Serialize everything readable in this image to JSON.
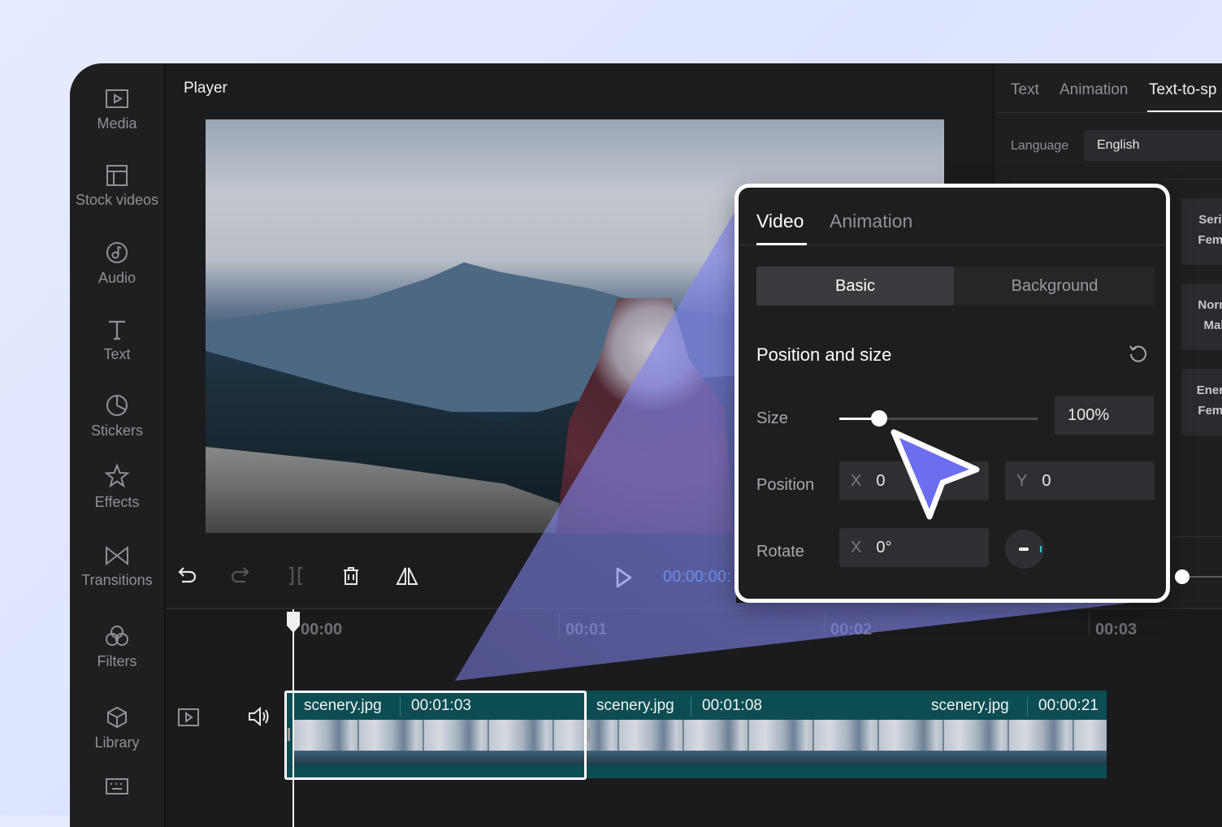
{
  "sidebar": {
    "items": [
      {
        "label": "Media",
        "icon": "play-square-icon"
      },
      {
        "label": "Stock videos",
        "icon": "layout-icon"
      },
      {
        "label": "Audio",
        "icon": "music-note-icon"
      },
      {
        "label": "Text",
        "icon": "text-t-icon"
      },
      {
        "label": "Stickers",
        "icon": "sticker-icon"
      },
      {
        "label": "Effects",
        "icon": "sparkle-star-icon"
      },
      {
        "label": "Transitions",
        "icon": "bowtie-icon"
      },
      {
        "label": "Filters",
        "icon": "filter-circles-icon"
      },
      {
        "label": "Library",
        "icon": "cube-icon"
      },
      {
        "label": "",
        "icon": "keyboard-icon"
      }
    ]
  },
  "player": {
    "title": "Player",
    "timecode": "00:00:00:"
  },
  "right_panel": {
    "tabs": [
      "Text",
      "Animation",
      "Text-to-sp"
    ],
    "active_tab": "Text-to-sp",
    "language_label": "Language",
    "language_value": "English",
    "voices": [
      "Serio\nFema",
      "Norm\nMal",
      "Energ\nFema"
    ]
  },
  "timeline": {
    "ticks": [
      "00:00",
      "00:01",
      "00:02",
      "00:03"
    ],
    "clips": [
      {
        "name": "scenery.jpg",
        "duration": "00:01:03"
      },
      {
        "name": "scenery.jpg",
        "duration": "00:01:08"
      },
      {
        "name": "scenery.jpg",
        "duration": "00:00:21"
      }
    ]
  },
  "video_panel": {
    "tabs": [
      "Video",
      "Animation"
    ],
    "segments": [
      "Basic",
      "Background"
    ],
    "section_title": "Position and size",
    "size_label": "Size",
    "size_value": "100%",
    "size_slider_fraction": 0.2,
    "position_label": "Position",
    "position_x_axis": "X",
    "position_x": "0",
    "position_y_axis": "Y",
    "position_y": "0",
    "rotate_label": "Rotate",
    "rotate_axis": "X",
    "rotate_value": "0°"
  },
  "colors": {
    "accent_timecode": "#3aa6e6",
    "clip_track": "#0b4d52",
    "cursor": "#6b6ef0",
    "cone": "#7d7fe8"
  }
}
